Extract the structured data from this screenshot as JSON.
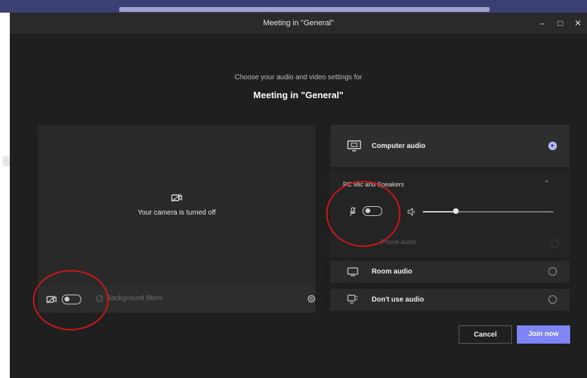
{
  "window": {
    "title": "Meeting in \"General\"",
    "controls": {
      "minimize": "–",
      "maximize": "□",
      "close": "✕"
    }
  },
  "prompt": {
    "subtitle": "Choose your audio and video settings for",
    "heading": "Meeting in \"General\""
  },
  "preview": {
    "camera_off_text": "Your camera is turned off",
    "background_filters_label": "Background filters"
  },
  "audio": {
    "options": [
      {
        "label": "Computer audio",
        "selected": true
      },
      {
        "label": "Phone audio",
        "selected": false
      },
      {
        "label": "Room audio",
        "selected": false
      },
      {
        "label": "Don't use audio",
        "selected": false
      }
    ],
    "device_label": "PC Mic and Speakers",
    "device_chevron": "⌃",
    "volume_percent": 25,
    "volume_icon": "speaker-icon",
    "mic_icon": "microphone-icon"
  },
  "actions": {
    "cancel_label": "Cancel",
    "join_label": "Join now"
  },
  "colors": {
    "accent": "#7f85f5",
    "annotation": "#d01818",
    "window_bg": "#1f1f1f"
  }
}
